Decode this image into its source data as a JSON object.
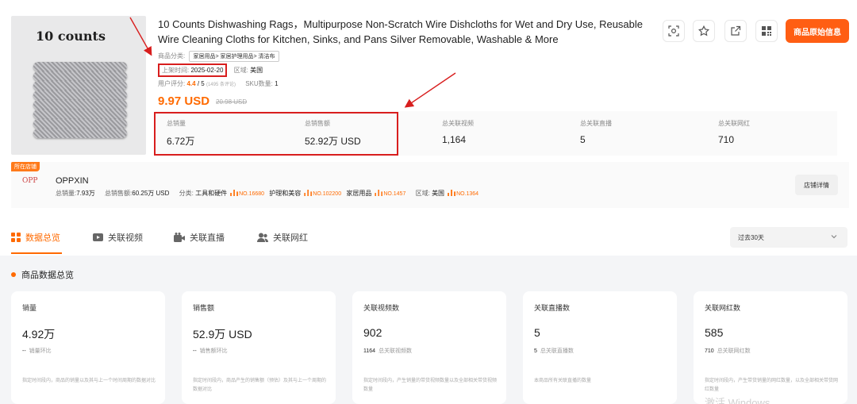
{
  "product": {
    "image_caption": "10 counts",
    "title": "10 Counts Dishwashing Rags，Multipurpose Non-Scratch Wire Dishcloths for Wet and Dry Use, Reusable Wire Cleaning Cloths for Kitchen, Sinks, and Pans Silver Removable, Washable & More",
    "category_label": "商品分类:",
    "category_path": "家居用品> 家居护理用品> 清洁布",
    "listed_label": "上架时间:",
    "listed_date": "2025-02-20",
    "region_label": "区域:",
    "region": "美国",
    "rating_label": "用户评分:",
    "rating": "4.4",
    "rating_max": "/ 5",
    "reviews": "(1495 条评论)",
    "sku_label": "SKU数量:",
    "sku": "1",
    "price": "9.97 USD",
    "original_price": "20.98 USD"
  },
  "actions": {
    "primary_label": "商品原始信息",
    "icons": [
      "scan-search-icon",
      "star-icon",
      "external-link-icon",
      "qr-code-icon"
    ]
  },
  "stats": [
    {
      "label": "总销量",
      "value": "6.72万"
    },
    {
      "label": "总销售额",
      "value": "52.92万 USD"
    },
    {
      "label": "总关联视频",
      "value": "1,164"
    },
    {
      "label": "总关联直播",
      "value": "5"
    },
    {
      "label": "总关联网红",
      "value": "710"
    }
  ],
  "store": {
    "badge": "所在店铺",
    "name": "OPPXIN",
    "logo_text": "OPP",
    "sales_label": "总销量:",
    "sales": "7.93万",
    "revenue_label": "总销售额:",
    "revenue": "60.25万 USD",
    "category_label": "分类:",
    "categories": [
      {
        "name": "工具和硬件",
        "rank": "NO.16680"
      },
      {
        "name": "护理和美容",
        "rank": "NO.102200"
      },
      {
        "name": "家居用品",
        "rank": "NO.1457"
      }
    ],
    "region_label": "区域:",
    "region": "美国",
    "region_rank": "NO.1364",
    "details_button": "店铺详情"
  },
  "tabs": [
    {
      "label": "数据总览",
      "icon": "grid-icon"
    },
    {
      "label": "关联视频",
      "icon": "video-icon"
    },
    {
      "label": "关联直播",
      "icon": "live-icon"
    },
    {
      "label": "关联网红",
      "icon": "users-icon"
    }
  ],
  "range": {
    "selected": "过去30天"
  },
  "overview": {
    "title": "商品数据总览",
    "cards": [
      {
        "label": "销量",
        "value": "4.92万",
        "sub_num": "--",
        "sub_label": "销量环比",
        "desc": "指定时间段内，商品的销量以及其与上一个时间周期的数据对比"
      },
      {
        "label": "销售额",
        "value": "52.9万 USD",
        "sub_num": "--",
        "sub_label": "销售额环比",
        "desc": "指定时间段内，商品产生的销售额（预估）及其与上一个周期的数据对比"
      },
      {
        "label": "关联视频数",
        "value": "902",
        "sub_num": "1164",
        "sub_label": "总关联视频数",
        "desc": "指定时间段内，产生销量的带货视频数量以及全部相关带货视频数量"
      },
      {
        "label": "关联直播数",
        "value": "5",
        "sub_num": "5",
        "sub_label": "总关联直播数",
        "desc": "本商品所有关联直播的数量"
      },
      {
        "label": "关联网红数",
        "value": "585",
        "sub_num": "710",
        "sub_label": "总关联网红数",
        "desc": "指定时间段内，产生带货销量的网红数量，以及全部相关带货网红数量"
      }
    ]
  },
  "watermark": "激活 Windows",
  "colors": {
    "accent": "#ff6a00",
    "annotation_red": "#d81e1e",
    "primary_button": "#ff5e13"
  }
}
